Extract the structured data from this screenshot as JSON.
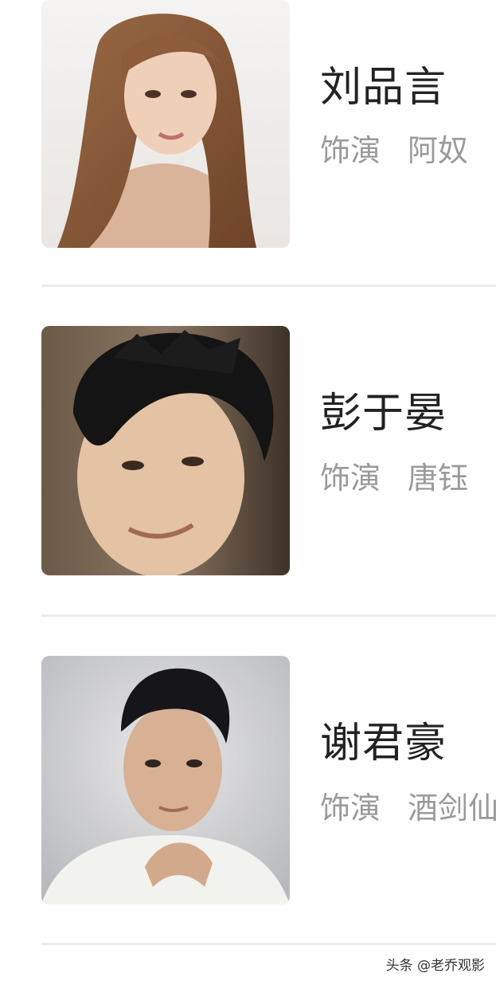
{
  "cast": [
    {
      "name": "刘品言",
      "role_label": "饰演",
      "character": "阿奴",
      "photo_icon": "actress-portrait-icon"
    },
    {
      "name": "彭于晏",
      "role_label": "饰演",
      "character": "唐钰",
      "photo_icon": "actor-portrait-icon"
    },
    {
      "name": "谢君豪",
      "role_label": "饰演",
      "character": "酒剑仙",
      "photo_icon": "actor-portrait-icon"
    }
  ],
  "watermark": "头条 @老乔观影",
  "colors": {
    "name_text": "#222222",
    "role_text": "#9a9a9a",
    "divider": "#ececec"
  }
}
